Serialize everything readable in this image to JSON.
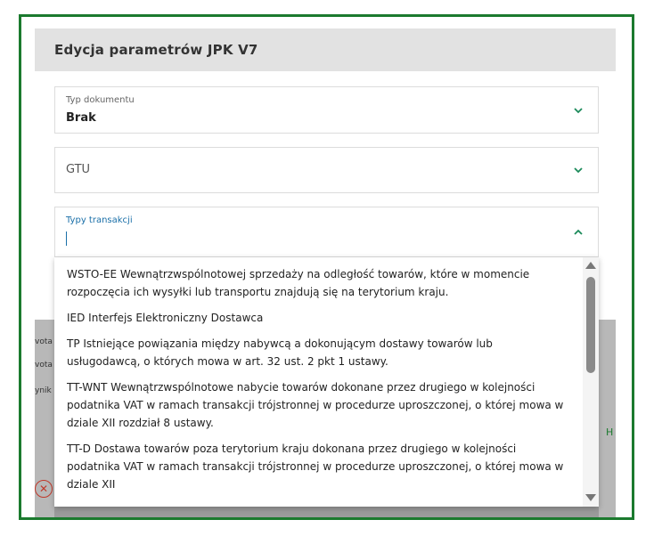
{
  "dialog": {
    "title": "Edycja parametrów JPK V7"
  },
  "fields": {
    "document_type": {
      "label": "Typ dokumentu",
      "value": "Brak"
    },
    "gtu": {
      "placeholder": "GTU"
    },
    "transaction_types": {
      "label": "Typy transakcji",
      "value": ""
    }
  },
  "dropdown": {
    "options": [
      "WSTO-EE Wewnątrzwspólnotowej sprzedaży na odległość towarów, które w momencie rozpoczęcia ich wysyłki lub transportu znajdują się na terytorium kraju.",
      "IED Interfejs Elektroniczny Dostawca",
      "TP Istniejące powiązania między nabywcą a dokonującym dostawy towarów lub usługodawcą, o których mowa w art. 32 ust. 2 pkt 1 ustawy.",
      "TT-WNT Wewnątrzwspólnotowe nabycie towarów dokonane przez drugiego w kolejności podatnika VAT w ramach transakcji trójstronnej w procedurze uproszczonej, o której mowa w dziale XII rozdział 8 ustawy.",
      "TT-D Dostawa towarów poza terytorium kraju dokonana przez drugiego w kolejności podatnika VAT w ramach transakcji trójstronnej w procedurze uproszczonej, o której mowa w dziale XII"
    ]
  },
  "background": {
    "left_fragments": [
      "vota z",
      "vota p",
      "ynik s"
    ],
    "right_fragment": "H"
  },
  "colors": {
    "frame_border": "#1b7a2e",
    "accent_green": "#1b8a5a",
    "focus_blue": "#1a6fa8"
  }
}
